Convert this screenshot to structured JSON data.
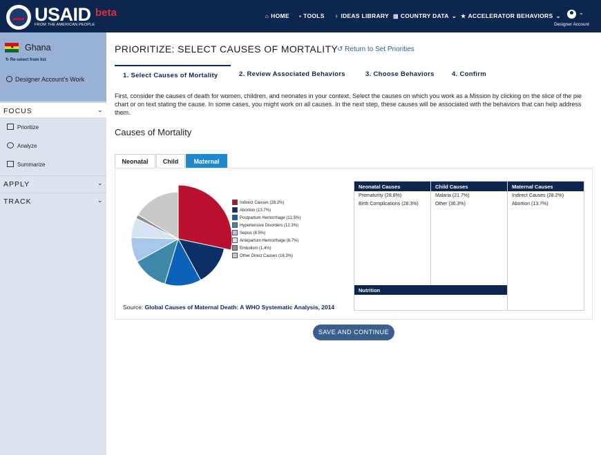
{
  "header": {
    "logo_text": "USAID",
    "logo_sub": "FROM THE AMERICAN PEOPLE",
    "beta": "beta",
    "nav": [
      {
        "label": "HOME",
        "icon": "home-icon"
      },
      {
        "label": "TOOLS",
        "icon": "lock-icon"
      },
      {
        "label": "IDEAS LIBRARY",
        "icon": "lightbulb-icon"
      },
      {
        "label": "COUNTRY DATA",
        "icon": "bar-chart-icon"
      },
      {
        "label": "ACCELERATOR BEHAVIORS",
        "icon": "star-icon"
      }
    ],
    "account_label": "Designer Account"
  },
  "sidebar": {
    "country": "Ghana",
    "reselect": "Re-select from list",
    "user_work": "Designer Account's Work",
    "sections": [
      {
        "title": "FOCUS",
        "items": [
          {
            "label": "Prioritize"
          },
          {
            "label": "Analyze"
          },
          {
            "label": "Summarize"
          }
        ]
      },
      {
        "title": "APPLY"
      },
      {
        "title": "TRACK"
      }
    ]
  },
  "main": {
    "title": "PRIORITIZE: SELECT CAUSES OF MORTALITY",
    "return_link": "Return to Set Priorities",
    "steps": [
      "1. Select Causes of Mortality",
      "2. Review Associated Behaviors",
      "3. Choose Behaviors",
      "4. Confirm"
    ],
    "description": "First, consider the causes of death for women, children, and neonates in your context. Select the causes on which you work as a Mission by clicking on the slice of the pie chart or on text stating the cause. In some cases, you might work on all causes. In the next step, these causes will be associated with the behaviors that can help address them.",
    "section_title": "Causes of Mortality",
    "tabs": [
      "Neonatal",
      "Child",
      "Maternal"
    ],
    "source_label": "Source:",
    "source_link": "Global Causes of Maternal Death: A WHO Systematic Analysis, 2014",
    "table": {
      "headers": [
        "Neonatal Causes",
        "Child Causes",
        "Maternal Causes"
      ],
      "neonatal": [
        "Prematurity (28.8%)",
        "Birth Complications (28.3%)"
      ],
      "child": [
        "Malaria (21.7%)",
        "Other (36.3%)"
      ],
      "maternal": [
        "Indirect Causes (28.2%)",
        "Abortion (13.7%)"
      ],
      "nutrition": "Nutrition"
    },
    "save_button": "SAVE AND CONTINUE"
  },
  "chart_data": {
    "type": "pie",
    "slices": [
      {
        "label": "Indirect Causes (28.2%)",
        "value": 28.2,
        "color": "#b8102e"
      },
      {
        "label": "Abortion (13.7%)",
        "value": 13.7,
        "color": "#0b2f66"
      },
      {
        "label": "Postpartum Hemorrhage (12.5%)",
        "value": 12.5,
        "color": "#0b62b8"
      },
      {
        "label": "Hypertensive Disorders (12.3%)",
        "value": 12.3,
        "color": "#3e88aa"
      },
      {
        "label": "Sepsis (8.5%)",
        "value": 8.5,
        "color": "#a7c6ea"
      },
      {
        "label": "Antepartum Hemorrhage (6.7%)",
        "value": 6.7,
        "color": "#d5e4f3"
      },
      {
        "label": "Embolism (1.4%)",
        "value": 1.4,
        "color": "#8f8f8f"
      },
      {
        "label": "Other Direct Causes (16.3%)",
        "value": 16.3,
        "color": "#c9c9c9"
      }
    ]
  }
}
